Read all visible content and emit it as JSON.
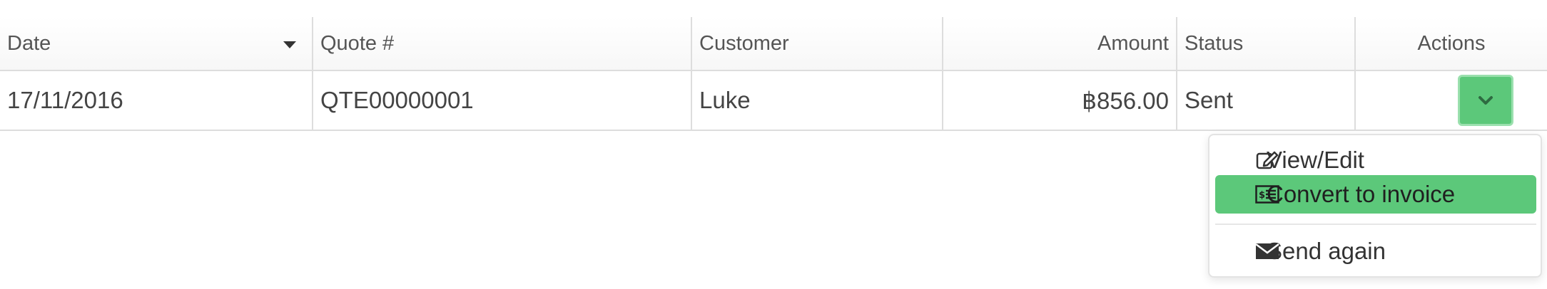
{
  "table": {
    "headers": {
      "date": "Date",
      "quote": "Quote #",
      "customer": "Customer",
      "amount": "Amount",
      "status": "Status",
      "actions": "Actions"
    },
    "rows": [
      {
        "date": "17/11/2016",
        "quote": "QTE00000001",
        "customer": "Luke",
        "amount": "฿856.00",
        "status": "Sent"
      }
    ]
  },
  "actions_menu": {
    "items": [
      {
        "label": "View/Edit",
        "icon": "edit-icon"
      },
      {
        "label": "Convert to invoice",
        "icon": "invoice-icon",
        "highlighted": true
      },
      {
        "label": "Send again",
        "icon": "envelope-icon"
      }
    ]
  },
  "colors": {
    "accent_green": "#5cc87a",
    "border": "#dddddd",
    "text": "#444444"
  },
  "icons": {
    "sort": "sort-caret-down-icon",
    "action_toggle": "chevron-down-icon"
  }
}
